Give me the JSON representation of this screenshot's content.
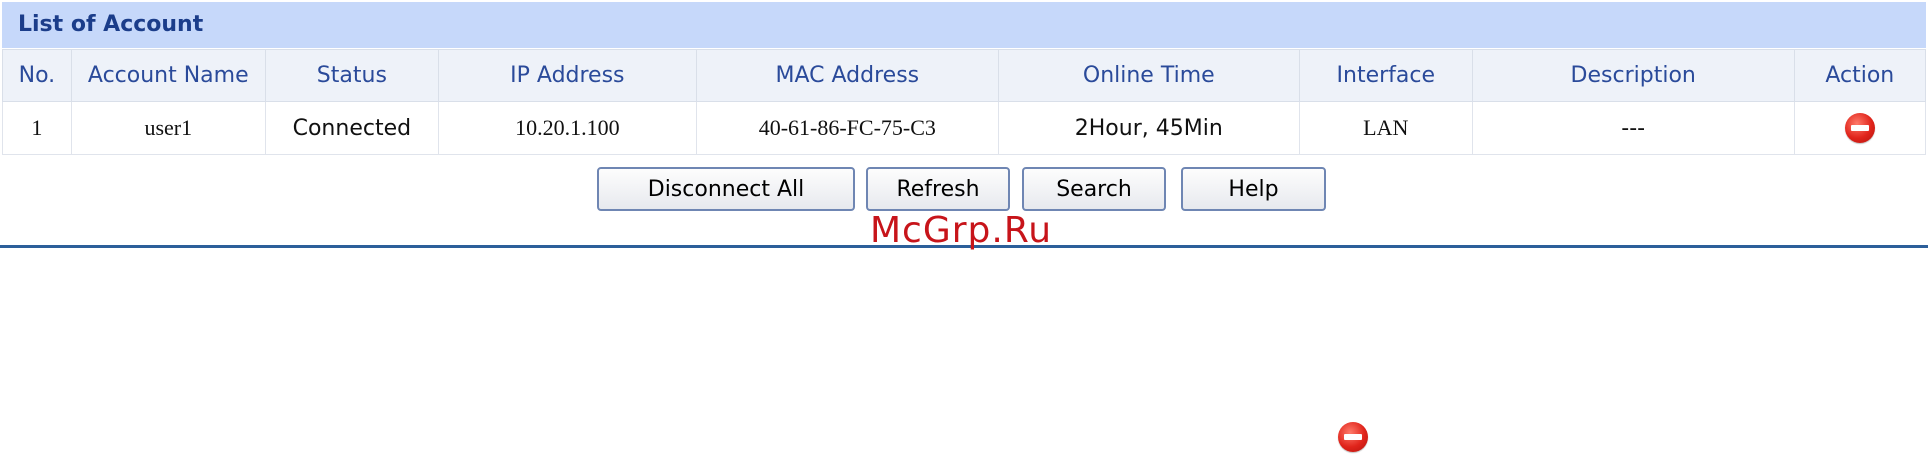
{
  "panel": {
    "title": "List of Account"
  },
  "table": {
    "columns": [
      "No.",
      "Account Name",
      "Status",
      "IP Address",
      "MAC Address",
      "Online Time",
      "Interface",
      "Description",
      "Action"
    ],
    "rows": [
      {
        "no": "1",
        "account_name": "user1",
        "status": "Connected",
        "ip": "10.20.1.100",
        "mac": "40-61-86-FC-75-C3",
        "online_time": "2Hour, 45Min",
        "interface": "LAN",
        "description": "---",
        "action_icon": "delete-icon"
      }
    ]
  },
  "buttons": {
    "disconnect_all": "Disconnect All",
    "refresh": "Refresh",
    "search": "Search",
    "help": "Help"
  },
  "watermark": "McGrp.Ru",
  "legend_icon": "delete-icon",
  "colors": {
    "title_bg": "#c6d8fa",
    "title_text": "#1b3d8a",
    "header_text": "#2a4a9a",
    "divider": "#2c5f9a",
    "delete_icon": "#e0241b",
    "watermark": "#c7141a"
  }
}
